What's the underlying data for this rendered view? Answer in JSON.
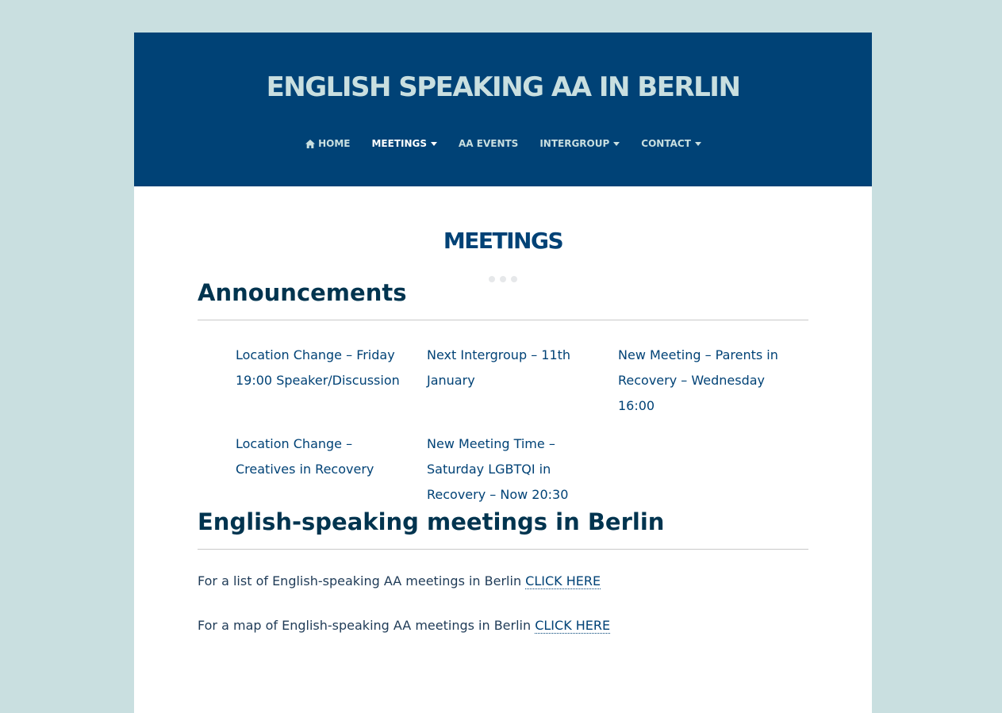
{
  "site": {
    "title": "ENGLISH SPEAKING AA IN BERLIN"
  },
  "nav": {
    "items": [
      {
        "label": "HOME",
        "icon": "home-icon",
        "active": false,
        "dropdown": false
      },
      {
        "label": "MEETINGS",
        "active": true,
        "dropdown": true
      },
      {
        "label": "AA EVENTS",
        "active": false,
        "dropdown": false
      },
      {
        "label": "INTERGROUP",
        "active": false,
        "dropdown": true
      },
      {
        "label": "CONTACT",
        "active": false,
        "dropdown": true
      }
    ]
  },
  "page": {
    "title": "MEETINGS"
  },
  "announcements": {
    "heading": "Announcements",
    "items": [
      "Location Change – Friday 19:00 Speaker/Discussion",
      "Next Intergroup – 11th January",
      "New Meeting – Parents in Recovery – Wednesday 16:00",
      "Location Change – Creatives in Recovery",
      "New Meeting Time – Saturday LGBTQI in Recovery – Now 20:30"
    ]
  },
  "meetings": {
    "heading": "English-speaking meetings in Berlin",
    "list_text": "For a list of English-speaking AA meetings in Berlin ",
    "list_link": "CLICK HERE",
    "map_text": "For a map of English-speaking AA meetings in Berlin ",
    "map_link": "CLICK HERE"
  },
  "colors": {
    "background": "#c9dfe0",
    "header": "#004276",
    "heading": "#00344f",
    "link": "#004276"
  }
}
